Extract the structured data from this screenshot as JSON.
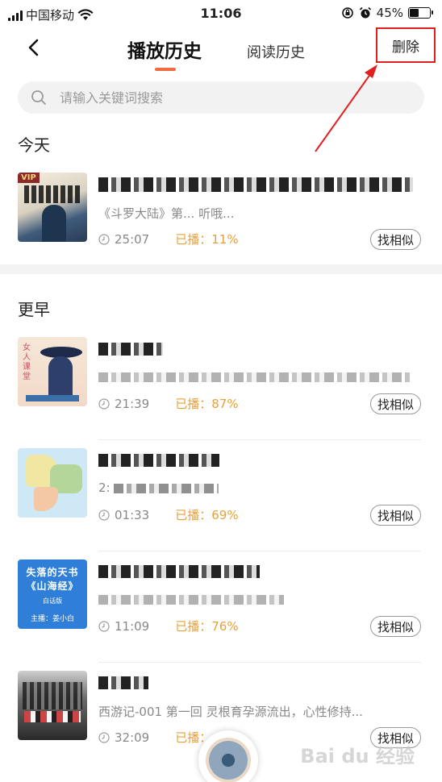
{
  "status": {
    "carrier": "中国移动",
    "time": "11:06",
    "battery": "45%",
    "battery_level": 0.45
  },
  "nav": {
    "tab_active": "播放历史",
    "tab_inactive": "阅读历史",
    "delete_label": "删除"
  },
  "search": {
    "placeholder": "请输入关键词搜索"
  },
  "sections": {
    "today": "今天",
    "earlier": "更早"
  },
  "items": [
    {
      "title": "",
      "desc": "《斗罗大陆》第... 听哦...",
      "duration": "25:07",
      "played": "已播：11%",
      "action": "找相似",
      "cover_badge": "VIP"
    },
    {
      "title": "",
      "desc": "...有...",
      "duration": "21:39",
      "played": "已播：87%",
      "action": "找相似",
      "cover_text": "女人课堂"
    },
    {
      "title": "",
      "desc": "2:",
      "duration": "01:33",
      "played": "已播：69%",
      "action": "找相似"
    },
    {
      "title": "",
      "desc": "",
      "duration": "11:09",
      "played": "已播：76%",
      "action": "找相似",
      "cover_text": "失落的天书《山海经》",
      "cover_sub": "白话版",
      "cover_host": "主播：姜小白"
    },
    {
      "title": "",
      "desc": "西游记-001 第一回 灵根育孕源流出，心性修持...",
      "duration": "32:09",
      "played": "已播：",
      "action": "找相似"
    }
  ],
  "watermark": "Bai du 经验",
  "colors": {
    "accent": "#f06a43",
    "played": "#e8a13a",
    "annotation": "#e02020"
  }
}
